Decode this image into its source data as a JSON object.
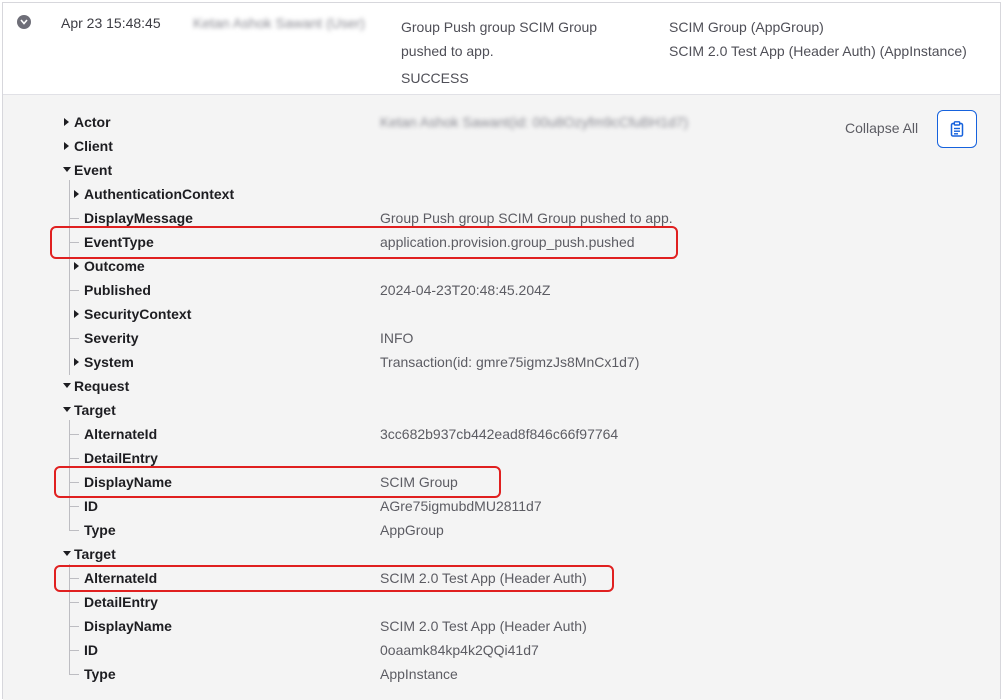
{
  "summary": {
    "time": "Apr 23 15:48:45",
    "actor_redacted": "Ketan Ashok Sawant (User)",
    "event_line1": "Group Push group SCIM Group",
    "event_line2": "pushed to app.",
    "outcome": "SUCCESS",
    "target1": "SCIM Group  (AppGroup)",
    "target2": "SCIM 2.0 Test App (Header Auth)  (AppInstance)"
  },
  "toolbar": {
    "collapse_all": "Collapse All",
    "copy_icon": "clipboard-icon",
    "accent_color": "#1662dd"
  },
  "actor": {
    "label": "Actor",
    "value_redacted": "Ketan Ashok Sawant(id: 00u8Ozyfm9cCfuBH1d7)"
  },
  "client": {
    "label": "Client"
  },
  "event": {
    "label": "Event",
    "fields": {
      "authentication_context": "AuthenticationContext",
      "display_message": "DisplayMessage",
      "display_message_value": "Group Push group SCIM Group pushed to app.",
      "event_type": "EventType",
      "event_type_value": "application.provision.group_push.pushed",
      "outcome": "Outcome",
      "published": "Published",
      "published_value": "2024-04-23T20:48:45.204Z",
      "security_context": "SecurityContext",
      "severity": "Severity",
      "severity_value": "INFO",
      "system": "System",
      "system_value": "Transaction(id: gmre75igmzJs8MnCx1d7)"
    }
  },
  "request": {
    "label": "Request"
  },
  "target1": {
    "label": "Target",
    "alternate_id": "AlternateId",
    "alternate_id_value": "3cc682b937cb442ead8f846c66f97764",
    "detail_entry": "DetailEntry",
    "display_name": "DisplayName",
    "display_name_value": "SCIM Group",
    "id": "ID",
    "id_value": "AGre75igmubdMU2811d7",
    "type": "Type",
    "type_value": "AppGroup"
  },
  "target2": {
    "label": "Target",
    "alternate_id": "AlternateId",
    "alternate_id_value": "SCIM 2.0 Test App (Header Auth)",
    "detail_entry": "DetailEntry",
    "display_name": "DisplayName",
    "display_name_value": "SCIM 2.0 Test App (Header Auth)",
    "id": "ID",
    "id_value": "0oaamk84kp4k2QQi41d7",
    "type": "Type",
    "type_value": "AppInstance"
  },
  "highlight_color": "#e02020"
}
